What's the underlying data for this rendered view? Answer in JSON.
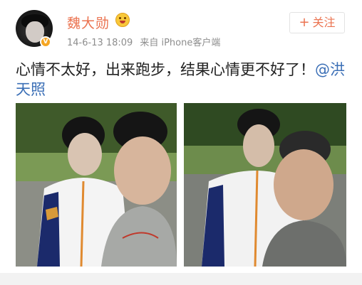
{
  "post": {
    "username": "魏大勋",
    "timestamp": "14-6-13 18:09",
    "source": "来自 iPhone客户端",
    "follow_label": "关注",
    "follow_plus": "+",
    "text": "心情不太好，出来跑步，结果心情更不好了！",
    "mention": "@洪天照"
  },
  "colors": {
    "username": "#eb7350",
    "mention": "#3b6fb6",
    "follow": "#eb7350"
  },
  "icons": {
    "verified": "verified-v-icon",
    "badge": "emoji-badge-icon"
  }
}
